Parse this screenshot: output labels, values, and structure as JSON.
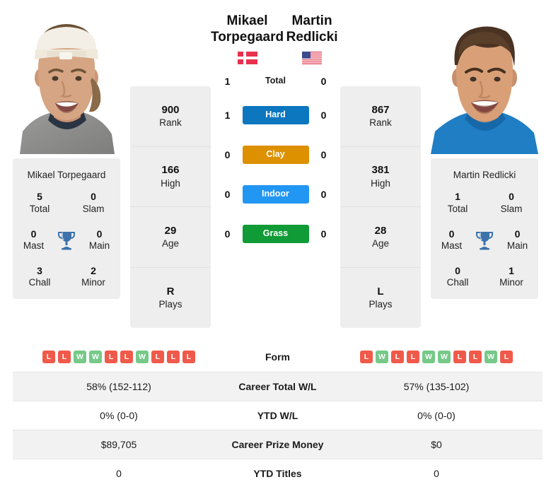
{
  "players": {
    "left": {
      "first_name": "Mikael",
      "last_name": "Torpegaard",
      "full_name": "Mikael Torpegaard",
      "country_flag": "denmark-flag",
      "photo": "player-photo-left",
      "titles": {
        "total": "5",
        "total_label": "Total",
        "slam": "0",
        "slam_label": "Slam",
        "mast": "0",
        "mast_label": "Mast",
        "main": "0",
        "main_label": "Main",
        "chall": "3",
        "chall_label": "Chall",
        "minor": "2",
        "minor_label": "Minor"
      },
      "ranks": [
        {
          "value": "900",
          "label": "Rank"
        },
        {
          "value": "166",
          "label": "High"
        },
        {
          "value": "29",
          "label": "Age"
        },
        {
          "value": "R",
          "label": "Plays"
        }
      ],
      "form": [
        "L",
        "L",
        "W",
        "W",
        "L",
        "L",
        "W",
        "L",
        "L",
        "L"
      ],
      "career_total_wl": "58% (152-112)",
      "ytd_wl": "0% (0-0)",
      "career_prize_money": "$89,705",
      "ytd_titles": "0"
    },
    "right": {
      "first_name": "Martin",
      "last_name": "Redlicki",
      "full_name": "Martin Redlicki",
      "country_flag": "usa-flag",
      "photo": "player-photo-right",
      "titles": {
        "total": "1",
        "total_label": "Total",
        "slam": "0",
        "slam_label": "Slam",
        "mast": "0",
        "mast_label": "Mast",
        "main": "0",
        "main_label": "Main",
        "chall": "0",
        "chall_label": "Chall",
        "minor": "1",
        "minor_label": "Minor"
      },
      "ranks": [
        {
          "value": "867",
          "label": "Rank"
        },
        {
          "value": "381",
          "label": "High"
        },
        {
          "value": "28",
          "label": "Age"
        },
        {
          "value": "L",
          "label": "Plays"
        }
      ],
      "form": [
        "L",
        "W",
        "L",
        "L",
        "W",
        "W",
        "L",
        "L",
        "W",
        "L"
      ],
      "career_total_wl": "57% (135-102)",
      "ytd_wl": "0% (0-0)",
      "career_prize_money": "$0",
      "ytd_titles": "0"
    }
  },
  "h2h": [
    {
      "label": "Total",
      "left": "1",
      "right": "0",
      "color": ""
    },
    {
      "label": "Hard",
      "left": "1",
      "right": "0",
      "color": "#0c76bf"
    },
    {
      "label": "Clay",
      "left": "0",
      "right": "0",
      "color": "#dd9000"
    },
    {
      "label": "Indoor",
      "left": "0",
      "right": "0",
      "color": "#2196f3"
    },
    {
      "label": "Grass",
      "left": "0",
      "right": "0",
      "color": "#109b36"
    }
  ],
  "table": {
    "rows": [
      {
        "label": "Form",
        "type": "form"
      },
      {
        "label": "Career Total W/L",
        "type": "text",
        "key": "career_total_wl"
      },
      {
        "label": "YTD W/L",
        "type": "text",
        "key": "ytd_wl"
      },
      {
        "label": "Career Prize Money",
        "type": "text",
        "key": "career_prize_money"
      },
      {
        "label": "YTD Titles",
        "type": "text",
        "key": "ytd_titles"
      }
    ]
  },
  "colors": {
    "card_bg": "#eeeeee",
    "stripe_bg": "#f2f2f2",
    "win_badge": "#76c989",
    "loss_badge": "#f05a4a",
    "trophy": "#3d72ab"
  }
}
